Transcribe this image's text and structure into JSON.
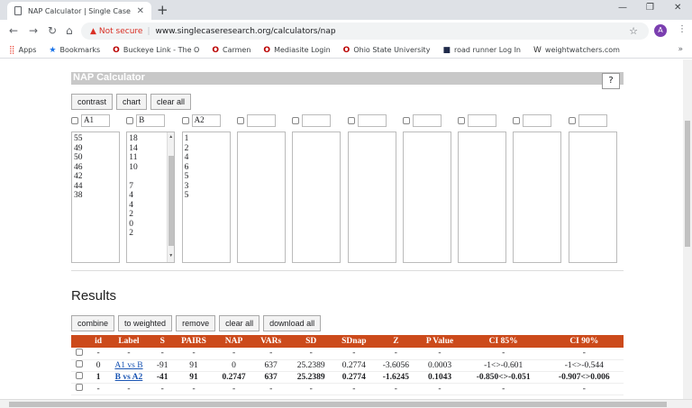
{
  "browser": {
    "tab_title": "NAP Calculator | Single Case Rese",
    "not_secure": "Not secure",
    "url": "www.singlecaseresearch.org/calculators/nap",
    "avatar_letter": "A"
  },
  "bookmarks": [
    {
      "label": "Apps",
      "icon": "apps-grid-icon"
    },
    {
      "label": "Bookmarks",
      "icon": "star-icon"
    },
    {
      "label": "Buckeye Link - The O",
      "icon": "osu-block-o-icon"
    },
    {
      "label": "Carmen",
      "icon": "osu-block-o-icon"
    },
    {
      "label": "Mediasite Login",
      "icon": "osu-block-o-icon"
    },
    {
      "label": "Ohio State University",
      "icon": "osu-block-o-icon"
    },
    {
      "label": "road runner Log In",
      "icon": "roadrunner-icon"
    },
    {
      "label": "weightwatchers.com",
      "icon": "ww-icon"
    }
  ],
  "calculator": {
    "title": "NAP Calculator",
    "help_label": "?",
    "buttons": {
      "contrast": "contrast",
      "chart": "chart",
      "clear_all": "clear all"
    },
    "columns": [
      {
        "name": "A1",
        "values": [
          "55",
          "49",
          "50",
          "46",
          "42",
          "44",
          "38"
        ]
      },
      {
        "name": "B",
        "values": [
          "18",
          "14",
          "11",
          "10",
          "",
          "7",
          "4",
          "4",
          "2",
          "0",
          "2"
        ]
      },
      {
        "name": "A2",
        "values": [
          "1",
          "2",
          "4",
          "6",
          "5",
          "3",
          "5"
        ]
      },
      {
        "name": "",
        "values": []
      },
      {
        "name": "",
        "values": []
      },
      {
        "name": "",
        "values": []
      },
      {
        "name": "",
        "values": []
      },
      {
        "name": "",
        "values": []
      },
      {
        "name": "",
        "values": []
      },
      {
        "name": "",
        "values": []
      }
    ]
  },
  "results": {
    "title": "Results",
    "buttons": {
      "combine": "combine",
      "to_weighted": "to weighted",
      "remove": "remove",
      "clear_all": "clear all",
      "download_all": "download all"
    },
    "headers": [
      "id",
      "Label",
      "S",
      "PAIRS",
      "NAP",
      "VARs",
      "SD",
      "SDnap",
      "Z",
      "P Value",
      "CI 85%",
      "CI 90%"
    ],
    "rows": [
      {
        "dashes": true,
        "cells": [
          "-",
          "-",
          "-",
          "-",
          "-",
          "-",
          "-",
          "-",
          "-",
          "-",
          "-",
          "-"
        ]
      },
      {
        "dashes": false,
        "bold": false,
        "cells": [
          "0",
          "A1 vs B",
          "-91",
          "91",
          "0",
          "637",
          "25.2389",
          "0.2774",
          "-3.6056",
          "0.0003",
          "-1<>-0.601",
          "-1<>-0.544"
        ]
      },
      {
        "dashes": false,
        "bold": true,
        "cells": [
          "1",
          "B vs A2",
          "-41",
          "91",
          "0.2747",
          "637",
          "25.2389",
          "0.2774",
          "-1.6245",
          "0.1043",
          "-0.850<>-0.051",
          "-0.907<>0.006"
        ]
      },
      {
        "dashes": true,
        "cells": [
          "-",
          "-",
          "-",
          "-",
          "-",
          "-",
          "-",
          "-",
          "-",
          "-",
          "-",
          "-"
        ]
      }
    ]
  }
}
